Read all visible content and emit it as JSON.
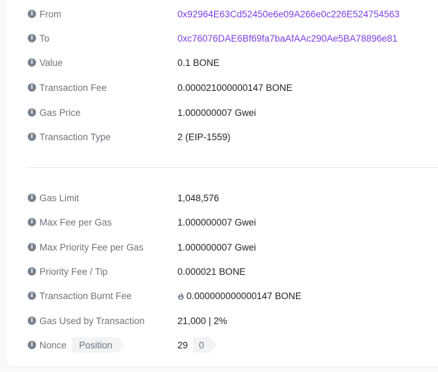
{
  "rows_top": [
    {
      "label": "From",
      "value": "0x92964E63Cd52450e6e09A266e0c226E524754563",
      "link": true
    },
    {
      "label": "To",
      "value": "0xc76076DAE6Bf69fa7baAfAAc290Ae5BA78896e81",
      "link": true
    },
    {
      "label": "Value",
      "value": "0.1 BONE"
    },
    {
      "label": "Transaction Fee",
      "value": "0.000021000000147 BONE"
    },
    {
      "label": "Gas Price",
      "value": "1.000000007 Gwei"
    },
    {
      "label": "Transaction Type",
      "value": "2 (EIP-1559)"
    }
  ],
  "rows_bottom": [
    {
      "label": "Gas Limit",
      "value": "1,048,576"
    },
    {
      "label": "Max Fee per Gas",
      "value": "1.000000007 Gwei"
    },
    {
      "label": "Max Priority Fee per Gas",
      "value": "1.000000007 Gwei"
    },
    {
      "label": "Priority Fee / Tip",
      "value": "0.000021 BONE"
    },
    {
      "label": "Transaction Burnt Fee",
      "value": "0.000000000000147 BONE"
    },
    {
      "label": "Gas Used by Transaction",
      "value": "21,000 | 2%"
    }
  ],
  "nonce": {
    "label": "Nonce",
    "position_label": "Position",
    "value": "29",
    "position_value": "0"
  },
  "icons": {
    "info": "info-icon",
    "burnt": "flame-icon"
  },
  "colors": {
    "link": "#7b3fe4",
    "label": "#6c757d"
  }
}
